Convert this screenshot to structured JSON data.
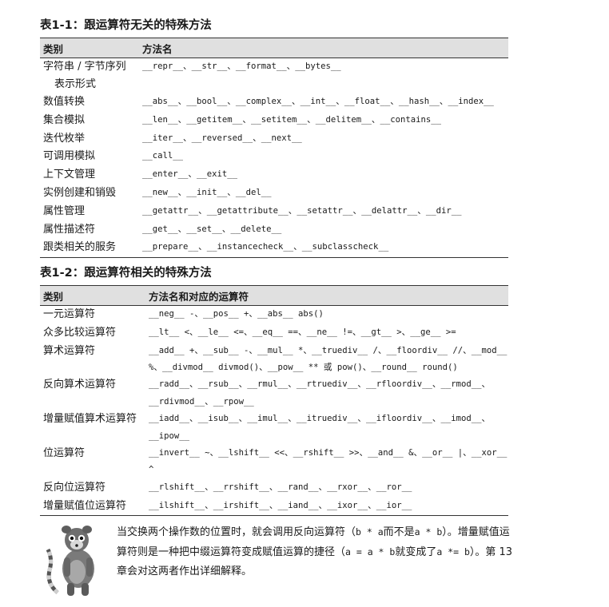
{
  "table1": {
    "caption": "表1-1：跟运算符无关的特殊方法",
    "headers": [
      "类别",
      "方法名"
    ],
    "rows": [
      {
        "category_line1": "字符串 / 字节序列",
        "category_line2": "表示形式",
        "methods": "__repr__、__str__、__format__、__bytes__"
      },
      {
        "category": "数值转换",
        "methods": "__abs__、__bool__、__complex__、__int__、__float__、__hash__、__index__"
      },
      {
        "category": "集合模拟",
        "methods": "__len__、__getitem__、__setitem__、__delitem__、__contains__"
      },
      {
        "category": "迭代枚举",
        "methods": "__iter__、__reversed__、__next__"
      },
      {
        "category": "可调用模拟",
        "methods": "__call__"
      },
      {
        "category": "上下文管理",
        "methods": "__enter__、__exit__"
      },
      {
        "category": "实例创建和销毁",
        "methods": "__new__、__init__、__del__"
      },
      {
        "category": "属性管理",
        "methods": "__getattr__、__getattribute__、__setattr__、__delattr__、__dir__"
      },
      {
        "category": "属性描述符",
        "methods": "__get__、__set__、__delete__"
      },
      {
        "category": "跟类相关的服务",
        "methods": "__prepare__、__instancecheck__、__subclasscheck__"
      }
    ]
  },
  "table2": {
    "caption": "表1-2：跟运算符相关的特殊方法",
    "headers": [
      "类别",
      "方法名和对应的运算符"
    ],
    "rows": [
      {
        "category": "一元运算符",
        "methods": "__neg__ -、__pos__ +、__abs__ abs()"
      },
      {
        "category": "众多比较运算符",
        "methods": "__lt__ <、__le__ <=、__eq__ ==、__ne__ !=、__gt__ >、__ge__ >="
      },
      {
        "category": "算术运算符",
        "methods": "__add__ +、__sub__ -、__mul__ *、__truediv__ /、__floordiv__ //、__mod__ %、__divmod__ divmod()、__pow__ ** 或 pow()、__round__ round()"
      },
      {
        "category": "反向算术运算符",
        "methods": "__radd__、__rsub__、__rmul__、__rtruediv__、__rfloordiv__、__rmod__、__rdivmod__、__rpow__"
      },
      {
        "category": "增量赋值算术运算符",
        "methods": "__iadd__、__isub__、__imul__、__itruediv__、__ifloordiv__、__imod__、__ipow__"
      },
      {
        "category": "位运算符",
        "methods": "__invert__ ~、__lshift__ <<、__rshift__ >>、__and__ &、__or__ |、__xor__ ^"
      },
      {
        "category": "反向位运算符",
        "methods": "__rlshift__、__rrshift__、__rand__、__rxor__、__ror__"
      },
      {
        "category": "增量赋值位运算符",
        "methods": "__ilshift__、__irshift__、__iand__、__ixor__、__ior__"
      }
    ]
  },
  "note": {
    "text1": "当交换两个操作数的位置时，就会调用反向运算符（",
    "code1": "b * a",
    "text2": "而不是",
    "code2": "a * b",
    "text3": "）。增量赋值运算符则是一种把中缀运算符变成赋值运算的捷径（",
    "code3": "a = a * b",
    "text4": "就变成了",
    "code4": "a *= b",
    "text5": "）。第 13 章会对这两者作出详细解释。"
  },
  "icons": {
    "note_icon": "lemur-icon"
  }
}
